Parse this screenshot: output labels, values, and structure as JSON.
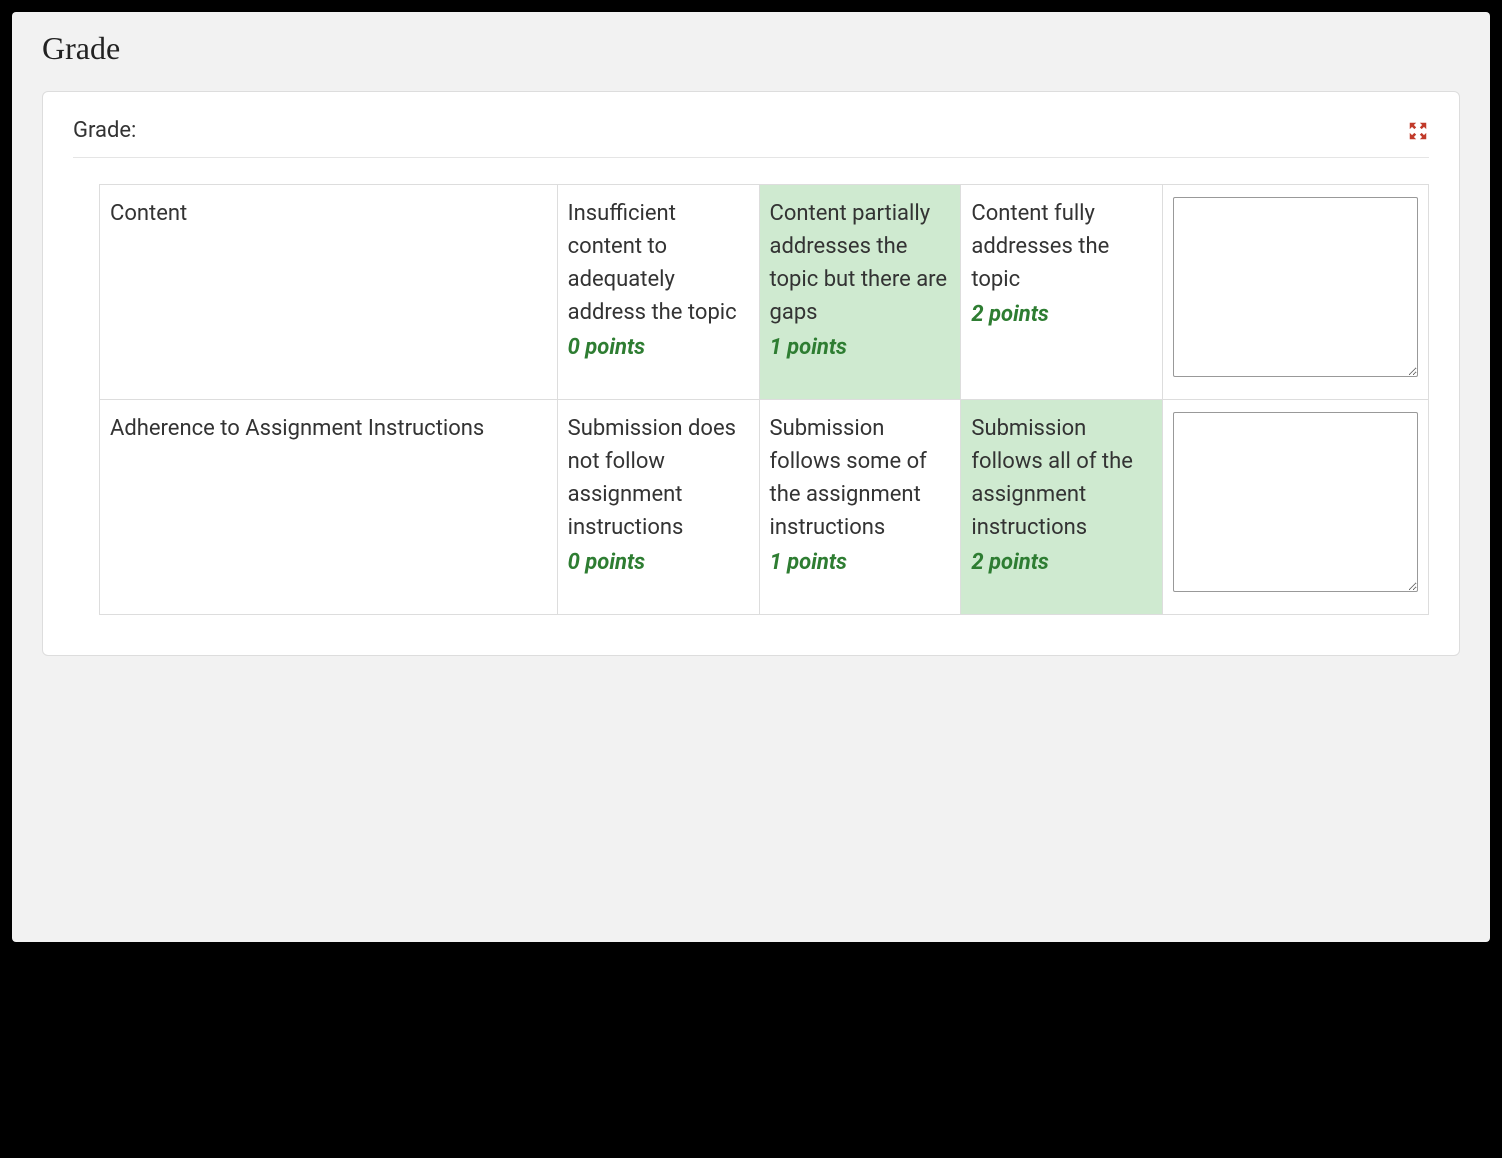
{
  "pageTitle": "Grade",
  "gradeLabel": "Grade:",
  "pointsWord": "points",
  "rubric": {
    "criteria": [
      {
        "name": "Content",
        "selectedIndex": 1,
        "levels": [
          {
            "desc": "Insufficient content to adequately address the topic",
            "points": "0"
          },
          {
            "desc": "Content partially addresses the topic but there are gaps",
            "points": "1"
          },
          {
            "desc": "Content fully addresses the topic",
            "points": "2"
          }
        ],
        "comment": ""
      },
      {
        "name": "Adherence to Assignment Instructions",
        "selectedIndex": 2,
        "levels": [
          {
            "desc": "Submission does not follow assignment instructions",
            "points": "0"
          },
          {
            "desc": "Submission follows some of the assignment instructions",
            "points": "1"
          },
          {
            "desc": "Submission follows all of the assignment instructions",
            "points": "2"
          }
        ],
        "comment": ""
      }
    ]
  }
}
